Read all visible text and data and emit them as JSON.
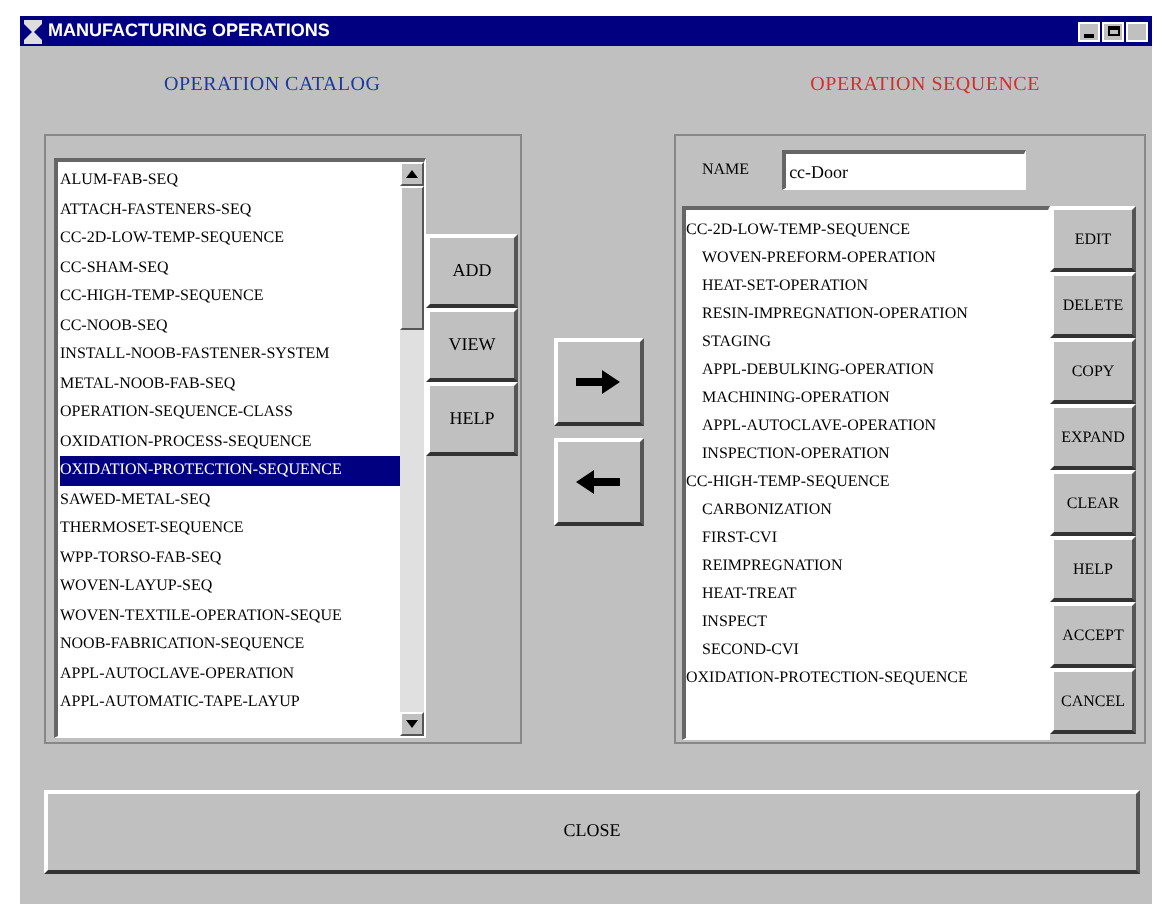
{
  "window": {
    "title": "MANUFACTURING OPERATIONS"
  },
  "catalog": {
    "title": "OPERATION CATALOG",
    "items": [
      {
        "label": "ALUM-FAB-SEQ",
        "selected": false
      },
      {
        "label": "ATTACH-FASTENERS-SEQ",
        "selected": false
      },
      {
        "label": "CC-2D-LOW-TEMP-SEQUENCE",
        "selected": false
      },
      {
        "label": "CC-SHAM-SEQ",
        "selected": false
      },
      {
        "label": "CC-HIGH-TEMP-SEQUENCE",
        "selected": false
      },
      {
        "label": "CC-NOOB-SEQ",
        "selected": false
      },
      {
        "label": "INSTALL-NOOB-FASTENER-SYSTEM",
        "selected": false
      },
      {
        "label": "METAL-NOOB-FAB-SEQ",
        "selected": false
      },
      {
        "label": "OPERATION-SEQUENCE-CLASS",
        "selected": false
      },
      {
        "label": "OXIDATION-PROCESS-SEQUENCE",
        "selected": false
      },
      {
        "label": "OXIDATION-PROTECTION-SEQUENCE",
        "selected": true
      },
      {
        "label": "SAWED-METAL-SEQ",
        "selected": false
      },
      {
        "label": "THERMOSET-SEQUENCE",
        "selected": false
      },
      {
        "label": "WPP-TORSO-FAB-SEQ",
        "selected": false
      },
      {
        "label": "WOVEN-LAYUP-SEQ",
        "selected": false
      },
      {
        "label": "WOVEN-TEXTILE-OPERATION-SEQUE",
        "selected": false
      },
      {
        "label": "NOOB-FABRICATION-SEQUENCE",
        "selected": false
      },
      {
        "label": "APPL-AUTOCLAVE-OPERATION",
        "selected": false
      },
      {
        "label": "APPL-AUTOMATIC-TAPE-LAYUP",
        "selected": false
      }
    ],
    "buttons": [
      "ADD",
      "VIEW",
      "HELP"
    ]
  },
  "sequence": {
    "title": "OPERATION SEQUENCE",
    "name_label": "NAME",
    "name_value": "cc-Door",
    "items": [
      {
        "label": "CC-2D-LOW-TEMP-SEQUENCE",
        "children": [
          {
            "label": "WOVEN-PREFORM-OPERATION"
          },
          {
            "label": "HEAT-SET-OPERATION"
          },
          {
            "label": "RESIN-IMPREGNATION-OPERATION"
          },
          {
            "label": "STAGING"
          },
          {
            "label": "APPL-DEBULKING-OPERATION"
          },
          {
            "label": "MACHINING-OPERATION"
          },
          {
            "label": "APPL-AUTOCLAVE-OPERATION"
          },
          {
            "label": "INSPECTION-OPERATION"
          }
        ]
      },
      {
        "label": "CC-HIGH-TEMP-SEQUENCE",
        "children": [
          {
            "label": "CARBONIZATION"
          },
          {
            "label": "FIRST-CVI"
          },
          {
            "label": "REIMPREGNATION"
          },
          {
            "label": "HEAT-TREAT"
          },
          {
            "label": "INSPECT"
          },
          {
            "label": "SECOND-CVI"
          }
        ]
      },
      {
        "label": "OXIDATION-PROTECTION-SEQUENCE"
      }
    ],
    "buttons": [
      "EDIT",
      "DELETE",
      "COPY",
      "EXPAND",
      "CLEAR",
      "HELP",
      "ACCEPT",
      "CANCEL"
    ]
  },
  "close_button": "CLOSE"
}
